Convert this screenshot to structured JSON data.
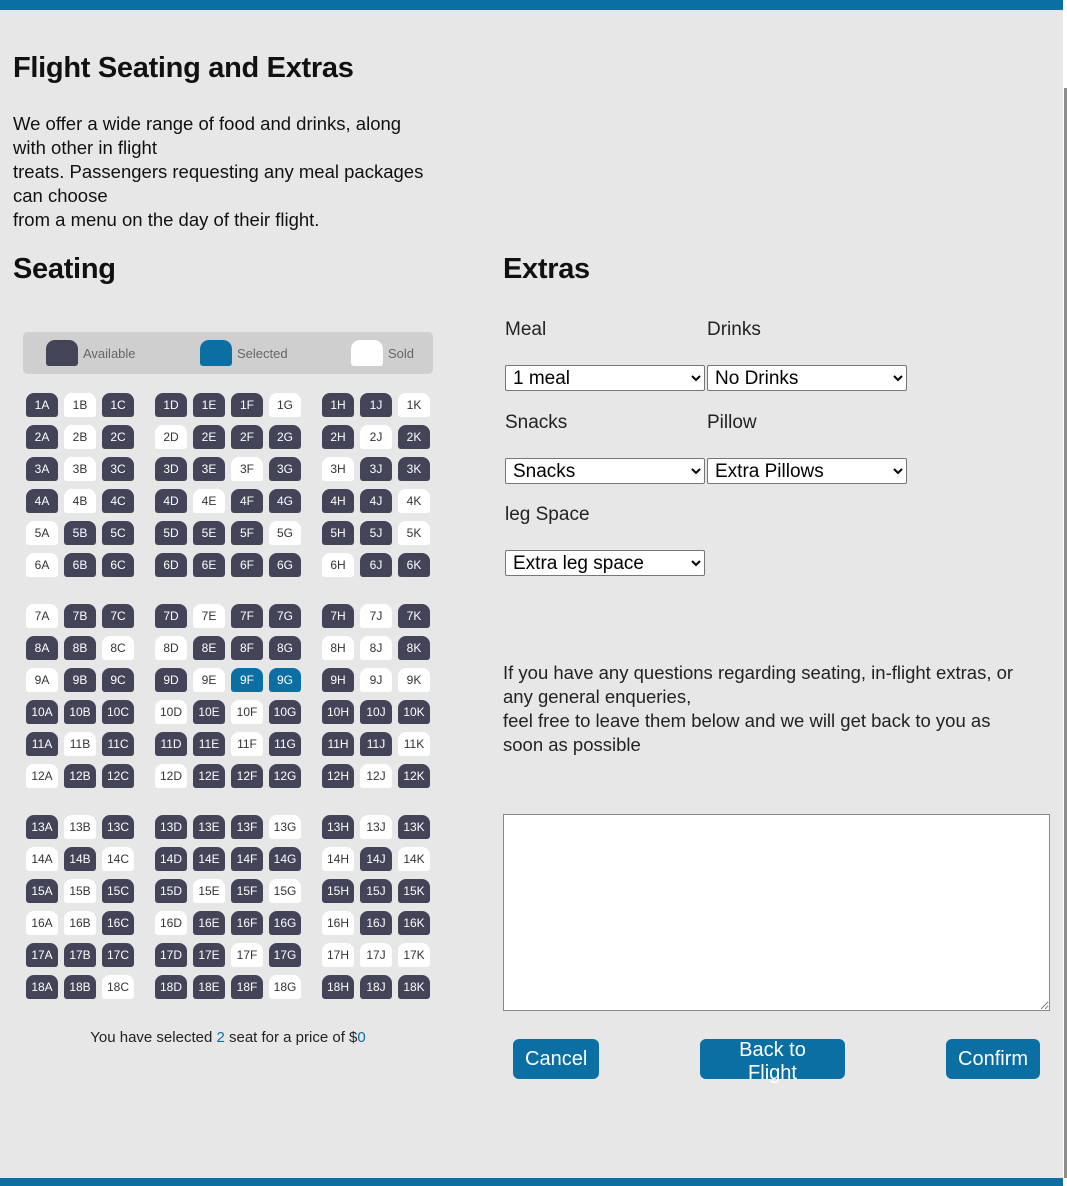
{
  "page": {
    "title": "Flight Seating and Extras",
    "intro_lines": [
      "We offer a wide range of food and drinks, along",
      "with other in flight",
      "treats. Passengers requesting any meal packages",
      "can choose",
      "from a menu on the day of their flight."
    ]
  },
  "colors": {
    "accent": "#0b6fa4",
    "seat_available": "#434458",
    "seat_sold": "#ffffff",
    "background": "#e7e7e7"
  },
  "seating": {
    "heading": "Seating",
    "legend": {
      "available": "Available",
      "selected": "Selected",
      "sold": "Sold"
    },
    "columns": [
      "A",
      "B",
      "C",
      "D",
      "E",
      "F",
      "G",
      "H",
      "J",
      "K"
    ],
    "rows": [
      {
        "row": 1,
        "status": [
          "a",
          "s",
          "a",
          "a",
          "a",
          "a",
          "s",
          "a",
          "a",
          "s"
        ]
      },
      {
        "row": 2,
        "status": [
          "a",
          "s",
          "a",
          "s",
          "a",
          "a",
          "a",
          "a",
          "s",
          "a"
        ]
      },
      {
        "row": 3,
        "status": [
          "a",
          "s",
          "a",
          "a",
          "a",
          "s",
          "a",
          "s",
          "a",
          "a"
        ]
      },
      {
        "row": 4,
        "status": [
          "a",
          "s",
          "a",
          "a",
          "s",
          "a",
          "a",
          "a",
          "a",
          "s"
        ]
      },
      {
        "row": 5,
        "status": [
          "s",
          "a",
          "a",
          "a",
          "a",
          "a",
          "s",
          "a",
          "a",
          "s"
        ]
      },
      {
        "row": 6,
        "status": [
          "s",
          "a",
          "a",
          "a",
          "a",
          "a",
          "a",
          "s",
          "a",
          "a"
        ]
      },
      {
        "row": 7,
        "status": [
          "s",
          "a",
          "a",
          "a",
          "s",
          "a",
          "a",
          "a",
          "s",
          "a"
        ]
      },
      {
        "row": 8,
        "status": [
          "a",
          "a",
          "s",
          "s",
          "a",
          "a",
          "a",
          "s",
          "s",
          "a"
        ]
      },
      {
        "row": 9,
        "status": [
          "s",
          "a",
          "a",
          "a",
          "s",
          "x",
          "x",
          "a",
          "s",
          "s"
        ]
      },
      {
        "row": 10,
        "status": [
          "a",
          "a",
          "a",
          "s",
          "a",
          "s",
          "a",
          "a",
          "a",
          "a"
        ]
      },
      {
        "row": 11,
        "status": [
          "a",
          "s",
          "a",
          "a",
          "a",
          "s",
          "a",
          "a",
          "a",
          "s"
        ]
      },
      {
        "row": 12,
        "status": [
          "s",
          "a",
          "a",
          "s",
          "a",
          "a",
          "a",
          "a",
          "s",
          "a"
        ]
      },
      {
        "row": 13,
        "status": [
          "a",
          "s",
          "a",
          "a",
          "a",
          "a",
          "s",
          "a",
          "s",
          "a"
        ]
      },
      {
        "row": 14,
        "status": [
          "s",
          "a",
          "s",
          "a",
          "a",
          "a",
          "a",
          "s",
          "a",
          "s"
        ]
      },
      {
        "row": 15,
        "status": [
          "a",
          "s",
          "a",
          "a",
          "s",
          "a",
          "s",
          "a",
          "a",
          "a"
        ]
      },
      {
        "row": 16,
        "status": [
          "s",
          "s",
          "a",
          "s",
          "a",
          "a",
          "a",
          "s",
          "a",
          "a"
        ]
      },
      {
        "row": 17,
        "status": [
          "a",
          "a",
          "a",
          "a",
          "a",
          "s",
          "a",
          "s",
          "s",
          "s"
        ]
      },
      {
        "row": 18,
        "status": [
          "a",
          "a",
          "s",
          "a",
          "a",
          "a",
          "s",
          "a",
          "a",
          "a"
        ]
      }
    ],
    "summary": {
      "prefix": "You have selected ",
      "count": "2",
      "middle": " seat for a price of $",
      "price": "0"
    }
  },
  "extras": {
    "heading": "Extras",
    "meal": {
      "label": "Meal",
      "value": "1 meal"
    },
    "drinks": {
      "label": "Drinks",
      "value": "No Drinks"
    },
    "snacks": {
      "label": "Snacks",
      "value": "Snacks"
    },
    "pillow": {
      "label": "Pillow",
      "value": "Extra Pillows"
    },
    "leg_space": {
      "label": "leg Space",
      "value": "Extra leg space"
    }
  },
  "questions": {
    "lines": [
      "If you have any questions regarding seating, in-flight extras, or",
      "any general enqueries,",
      "feel free to leave them below and we will get back to you as",
      "soon as possible"
    ],
    "textarea_value": ""
  },
  "buttons": {
    "cancel": "Cancel",
    "back": "Back to Flight",
    "confirm": "Confirm"
  }
}
